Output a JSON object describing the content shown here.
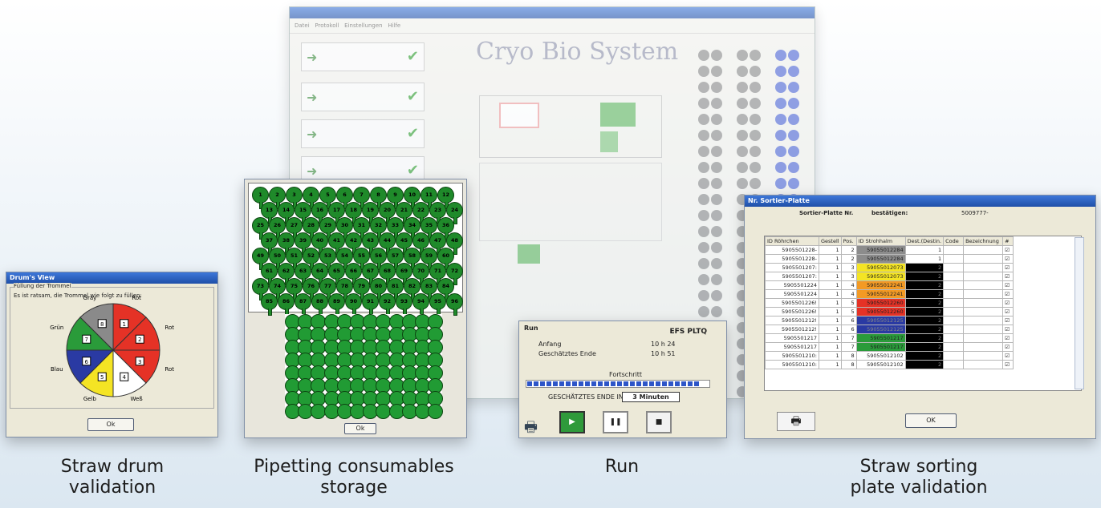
{
  "captions": {
    "drum": [
      "Straw drum",
      "validation"
    ],
    "pipet": [
      "Pipetting consumables",
      "storage"
    ],
    "run": [
      "Run"
    ],
    "sort": [
      "Straw sorting",
      "plate validation"
    ]
  },
  "drum": {
    "title": "Drum's View",
    "group": "Füllung der Trommel",
    "instruction": "Es ist ratsam, die Trommel wie folgt zu füllen:",
    "ok": "Ok",
    "segments": [
      {
        "num": "1",
        "label": "Rot",
        "color": "#e53226"
      },
      {
        "num": "2",
        "label": "Rot",
        "color": "#e53226"
      },
      {
        "num": "3",
        "label": "Rot",
        "color": "#e53226"
      },
      {
        "num": "4",
        "label": "Weß",
        "color": "#ffffff"
      },
      {
        "num": "5",
        "label": "Gelb",
        "color": "#f4e424"
      },
      {
        "num": "6",
        "label": "Blau",
        "color": "#2a3aa3"
      },
      {
        "num": "7",
        "label": "Grün",
        "color": "#2a9b3a"
      },
      {
        "num": "8",
        "label": "Gray",
        "color": "#8a8a8a"
      }
    ]
  },
  "pipet": {
    "ok": "Ok",
    "tip_count": 96
  },
  "run": {
    "section": "Run",
    "code": "EFS PLTQ",
    "start_label": "Anfang",
    "start_value": "10 h 24",
    "end_label": "Geschätztes Ende",
    "end_value": "10 h 51",
    "progress_label": "Fortschritt",
    "progress": 0.95,
    "eta_label": "GESCHÄTZTES ENDE IN",
    "eta_value": "3 Minuten"
  },
  "sort": {
    "title": "Nr. Sortier-Platte",
    "plate_label": "Sortier-Platte Nr.",
    "confirm_label": "bestätigen:",
    "plate_value": "5009777-",
    "ok": "OK",
    "columns": [
      "ID Röhrchen",
      "Gestell",
      "Pos.",
      "ID Strohhalm",
      "Dest.(Destin.",
      "Code",
      "Bezeichnung",
      "#"
    ],
    "rows": [
      {
        "tube": "5905501228-",
        "rack": "1",
        "pos": "2",
        "straw": "59055012284",
        "straw_color": "#8c8c8c",
        "dest": "1",
        "dest_color": "#ffffff"
      },
      {
        "tube": "5905501228-",
        "rack": "1",
        "pos": "2",
        "straw": "59055012284",
        "straw_color": "#8c8c8c",
        "dest": "1",
        "dest_color": "#ffffff"
      },
      {
        "tube": "5905501207:",
        "rack": "1",
        "pos": "3",
        "straw": "59055012073",
        "straw_color": "#f4e424",
        "dest": "2",
        "dest_color": "#000000"
      },
      {
        "tube": "5905501207:",
        "rack": "1",
        "pos": "3",
        "straw": "59055012073",
        "straw_color": "#f4e424",
        "dest": "2",
        "dest_color": "#000000"
      },
      {
        "tube": "5905501224",
        "rack": "1",
        "pos": "4",
        "straw": "59055012241",
        "straw_color": "#f39a24",
        "dest": "2",
        "dest_color": "#000000"
      },
      {
        "tube": "5905501224",
        "rack": "1",
        "pos": "4",
        "straw": "59055012241",
        "straw_color": "#f39a24",
        "dest": "2",
        "dest_color": "#000000"
      },
      {
        "tube": "5905501226!",
        "rack": "1",
        "pos": "5",
        "straw": "59055012260",
        "straw_color": "#e53226",
        "dest": "2",
        "dest_color": "#000000"
      },
      {
        "tube": "5905501226!",
        "rack": "1",
        "pos": "5",
        "straw": "59055012260",
        "straw_color": "#e53226",
        "dest": "2",
        "dest_color": "#000000"
      },
      {
        "tube": "5905501212!",
        "rack": "1",
        "pos": "6",
        "straw": "59055012125",
        "straw_color": "#2a3aa3",
        "dest": "2",
        "dest_color": "#000000"
      },
      {
        "tube": "5905501212!",
        "rack": "1",
        "pos": "6",
        "straw": "59055012125",
        "straw_color": "#2a3aa3",
        "dest": "2",
        "dest_color": "#000000"
      },
      {
        "tube": "5905501217",
        "rack": "1",
        "pos": "7",
        "straw": "5905501217",
        "straw_color": "#2a9b3a",
        "dest": "2",
        "dest_color": "#000000"
      },
      {
        "tube": "5905501217",
        "rack": "1",
        "pos": "7",
        "straw": "5905501217",
        "straw_color": "#2a9b3a",
        "dest": "2",
        "dest_color": "#000000"
      },
      {
        "tube": "5905501210:",
        "rack": "1",
        "pos": "8",
        "straw": "59055012102",
        "straw_color": "#ffffff",
        "dest": "2",
        "dest_color": "#000000"
      },
      {
        "tube": "5905501210:",
        "rack": "1",
        "pos": "8",
        "straw": "59055012102",
        "straw_color": "#ffffff",
        "dest": "2",
        "dest_color": "#000000"
      }
    ]
  },
  "background": {
    "logo": "Cryo Bio System",
    "menu": [
      "Datei",
      "Protokoll",
      "Einstellungen",
      "Hilfe"
    ]
  }
}
